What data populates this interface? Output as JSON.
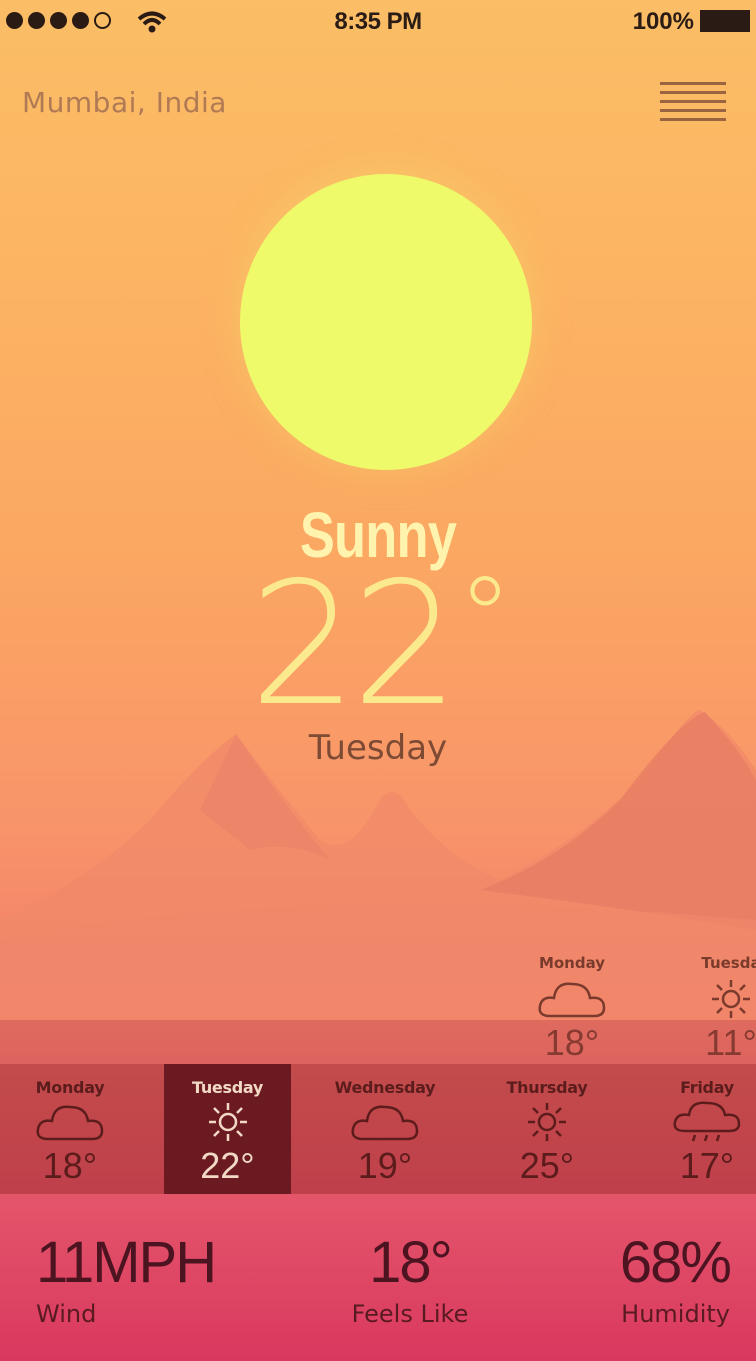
{
  "status_bar": {
    "time": "8:35 PM",
    "battery": "100%",
    "signal_bars": 4,
    "signal_total": 5
  },
  "header": {
    "location": "Mumbai, India",
    "menu_icon": "hamburger-menu-icon"
  },
  "current": {
    "condition": "Sunny",
    "temperature": "22",
    "degree_symbol": "°",
    "day": "Tuesday",
    "sun_color": "#eefa6a"
  },
  "upcoming": [
    {
      "day": "Monday",
      "icon": "cloud-icon",
      "temp": "18°"
    },
    {
      "day": "Tuesda",
      "icon": "sun-icon",
      "temp": "11°"
    }
  ],
  "forecast": [
    {
      "day": "Monday",
      "icon": "cloud-icon",
      "temp": "18°",
      "active": false
    },
    {
      "day": "Tuesday",
      "icon": "sun-icon",
      "temp": "22°",
      "active": true
    },
    {
      "day": "Wednesday",
      "icon": "cloud-icon",
      "temp": "19°",
      "active": false
    },
    {
      "day": "Thursday",
      "icon": "sun-icon",
      "temp": "25°",
      "active": false
    },
    {
      "day": "Friday",
      "icon": "rain-cloud-icon",
      "temp": "17°",
      "active": false
    }
  ],
  "stats": {
    "wind": {
      "value": "11MPH",
      "label": "Wind"
    },
    "feels_like": {
      "value": "18°",
      "label": "Feels Like"
    },
    "humidity": {
      "value": "68%",
      "label": "Humidity"
    }
  },
  "colors": {
    "accent_active": "#6b1a22",
    "text_dark": "#4c1420",
    "sun": "#eefa6a"
  }
}
